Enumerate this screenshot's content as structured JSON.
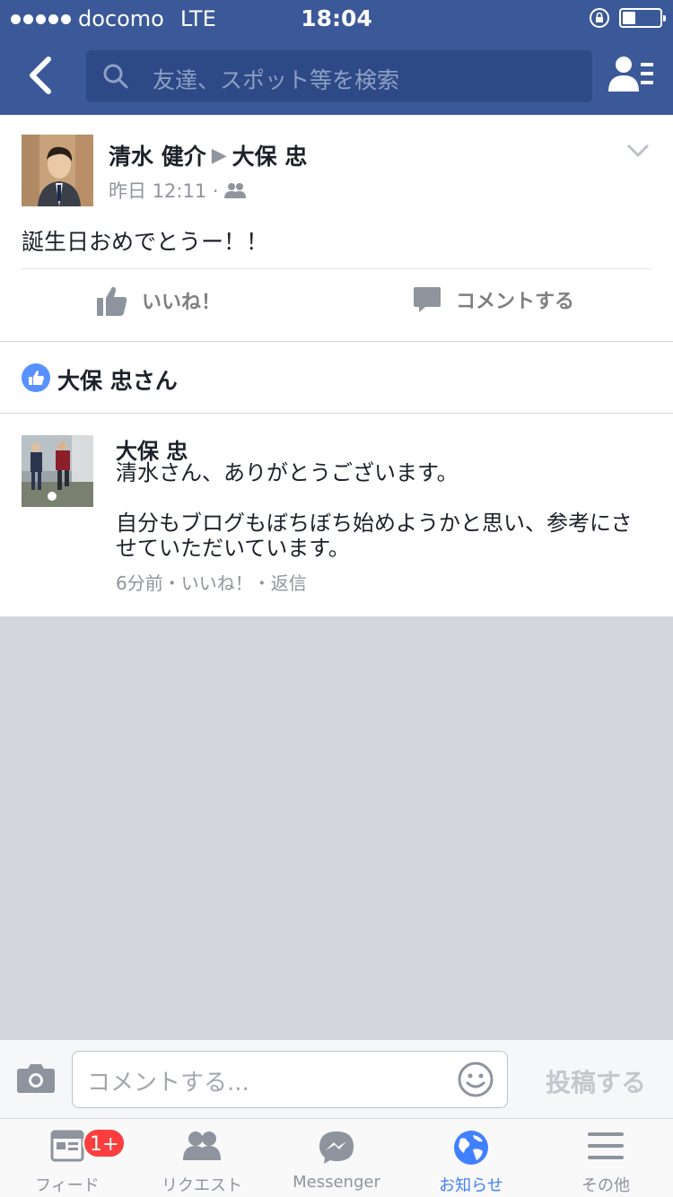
{
  "status_bar": {
    "carrier": "docomo",
    "network": "LTE",
    "time": "18:04"
  },
  "nav": {
    "search_placeholder": "友達、スポット等を検索"
  },
  "post": {
    "author": "清水 健介",
    "target": "大保 忠",
    "time": "昨日 12:11 ·",
    "text": "誕生日おめでとうー！！",
    "like_label": "いいね！",
    "comment_label": "コメントする"
  },
  "likes": {
    "label": "大保 忠さん"
  },
  "comment": {
    "author": "大保 忠",
    "body": "清水さん、ありがとうございます。\n\n自分もブログもぼちぼち始めようかと思い、参考にさせていただいています。",
    "meta": "6分前・いいね！・返信"
  },
  "composer": {
    "placeholder": "コメントする...",
    "post_label": "投稿する"
  },
  "tabs": [
    {
      "label": "フィード",
      "badge": "1+"
    },
    {
      "label": "リクエスト"
    },
    {
      "label": "Messenger"
    },
    {
      "label": "お知らせ"
    },
    {
      "label": "その他"
    }
  ],
  "colors": {
    "brand": "#3b5998",
    "accent": "#4080ff",
    "badge": "#fa3e3e"
  }
}
